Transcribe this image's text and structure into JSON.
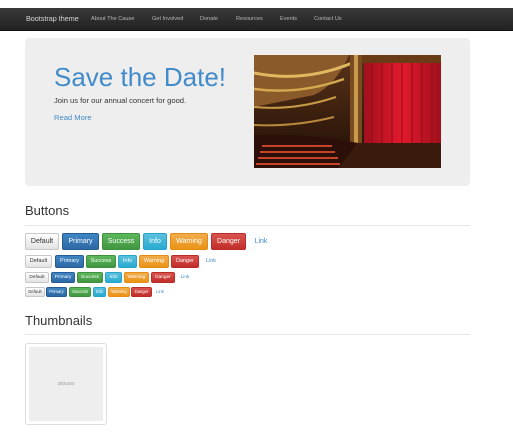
{
  "navbar": {
    "brand": "Bootstrap theme",
    "items": [
      "About The Cause",
      "Get Involved",
      "Donate",
      "Resources",
      "Events",
      "Contact Us"
    ]
  },
  "jumbotron": {
    "title": "Save the Date!",
    "lead": "Join us for our annual concert for good.",
    "link": "Read More"
  },
  "buttons_section": {
    "title": "Buttons",
    "labels": [
      "Default",
      "Primary",
      "Success",
      "Info",
      "Warning",
      "Danger",
      "Link"
    ]
  },
  "thumbnails_section": {
    "title": "Thumbnails",
    "placeholder": "300x200"
  },
  "colors": {
    "primary": "#428bca",
    "success": "#5cb85c",
    "info": "#5bc0de",
    "warning": "#f0ad4e",
    "danger": "#d9534f"
  }
}
